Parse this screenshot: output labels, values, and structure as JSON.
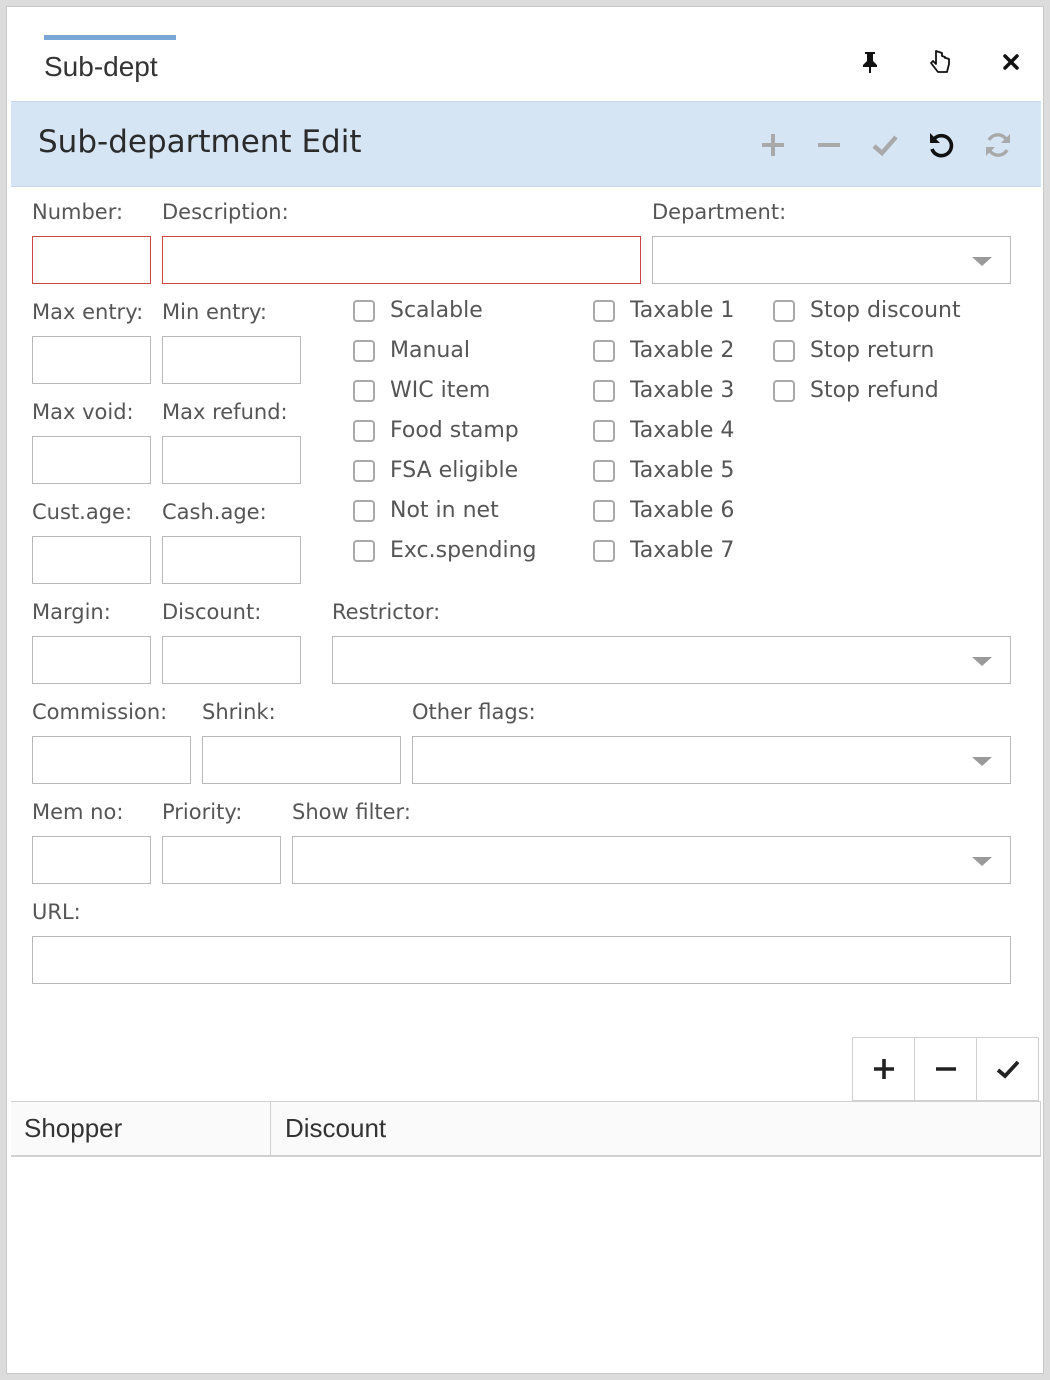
{
  "window": {
    "tab_title": "Sub-dept",
    "icons": [
      "pin-icon",
      "pointer-icon",
      "close-icon"
    ]
  },
  "header": {
    "title": "Sub-department Edit",
    "actions": [
      "add-icon",
      "remove-icon",
      "check-icon",
      "undo-icon",
      "refresh-icon"
    ]
  },
  "form": {
    "labels": {
      "number": "Number:",
      "description": "Description:",
      "department": "Department:",
      "max_entry": "Max entry:",
      "min_entry": "Min entry:",
      "max_void": "Max void:",
      "max_refund": "Max refund:",
      "cust_age": "Cust.age:",
      "cash_age": "Cash.age:",
      "margin": "Margin:",
      "discount": "Discount:",
      "restrictor": "Restrictor:",
      "commission": "Commission:",
      "shrink": "Shrink:",
      "other_flags": "Other flags:",
      "mem_no": "Mem no:",
      "priority": "Priority:",
      "show_filter": "Show filter:",
      "url": "URL:"
    },
    "checkboxes_col1": [
      "Scalable",
      "Manual",
      "WIC item",
      "Food stamp",
      "FSA eligible",
      "Not in net",
      "Exc.spending"
    ],
    "checkboxes_col2": [
      "Taxable 1",
      "Taxable 2",
      "Taxable 3",
      "Taxable 4",
      "Taxable 5",
      "Taxable 6",
      "Taxable 7"
    ],
    "checkboxes_col3": [
      "Stop discount",
      "Stop return",
      "Stop refund"
    ]
  },
  "grid": {
    "buttons": [
      "add-icon",
      "remove-icon",
      "check-icon"
    ],
    "columns": [
      "Shopper",
      "Discount"
    ]
  },
  "colors": {
    "header_bg": "#d6e5f4",
    "required_border": "#c9473f",
    "tab_accent": "#7aa6d8"
  }
}
